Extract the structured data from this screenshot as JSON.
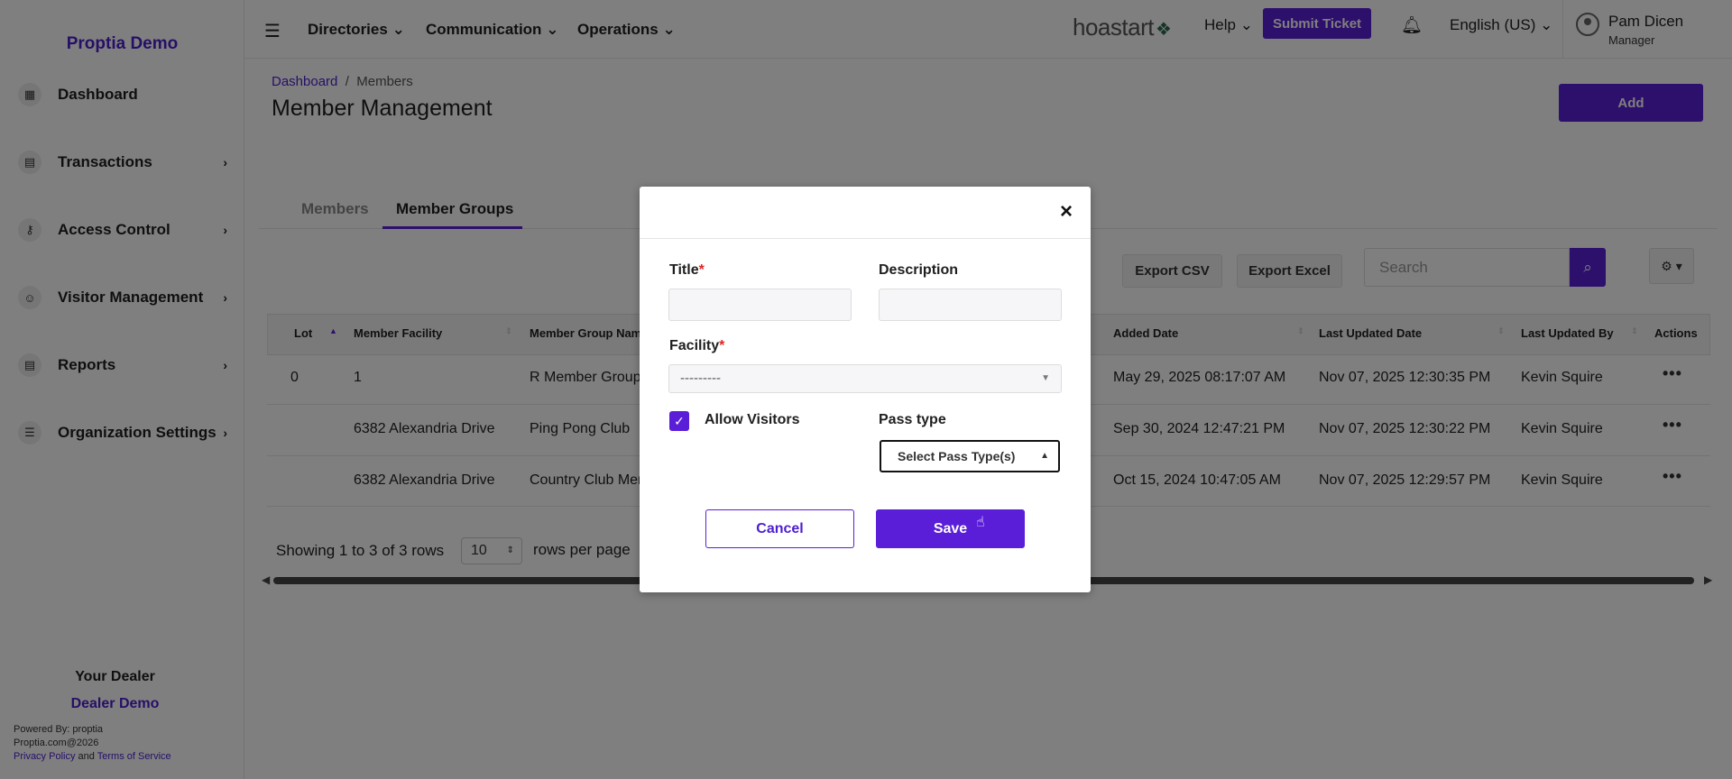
{
  "sidebar": {
    "brand": "Proptia Demo",
    "items": [
      {
        "label": "Dashboard",
        "icon": "dashboard-icon"
      },
      {
        "label": "Transactions",
        "icon": "receipt-icon"
      },
      {
        "label": "Access Control",
        "icon": "key-icon"
      },
      {
        "label": "Visitor Management",
        "icon": "visitor-icon"
      },
      {
        "label": "Reports",
        "icon": "report-icon"
      },
      {
        "label": "Organization Settings",
        "icon": "server-icon"
      }
    ],
    "dealer_title": "Your Dealer",
    "dealer_name": "Dealer Demo",
    "powered_by": "Powered By: proptia",
    "copyright": "Proptia.com@2026",
    "privacy": "Privacy Policy",
    "and": "and",
    "terms": "Terms of Service"
  },
  "topbar": {
    "menus": [
      "Directories",
      "Communication",
      "Operations"
    ],
    "logo": "hoastart",
    "help": "Help",
    "submit_ticket": "Submit Ticket",
    "language": "English (US)",
    "user_name": "Pam Dicen",
    "user_role": "Manager"
  },
  "main": {
    "breadcrumb_home": "Dashboard",
    "breadcrumb_sep": "/",
    "breadcrumb_current": "Members",
    "title": "Member Management",
    "add_label": "Add",
    "tabs": [
      "Members",
      "Member Groups"
    ],
    "export_csv": "Export CSV",
    "export_excel": "Export Excel",
    "search_placeholder": "Search",
    "columns": [
      "Lot",
      "Member Facility",
      "Member Group Name",
      "Added Date",
      "Last Updated Date",
      "Last Updated By",
      "Actions"
    ],
    "rows": [
      {
        "lot": "0",
        "facility": "1",
        "group": "R Member Group",
        "added": "May 29, 2025 08:17:07 AM",
        "updated": "Nov 07, 2025 12:30:35 PM",
        "by": "Kevin Squire"
      },
      {
        "lot": "",
        "facility": "6382 Alexandria Drive",
        "group": "Ping Pong Club",
        "added": "Sep 30, 2024 12:47:21 PM",
        "updated": "Nov 07, 2025 12:30:22 PM",
        "by": "Kevin Squire"
      },
      {
        "lot": "",
        "facility": "6382 Alexandria Drive",
        "group": "Country Club Mer",
        "added": "Oct 15, 2024 10:47:05 AM",
        "updated": "Nov 07, 2025 12:29:57 PM",
        "by": "Kevin Squire"
      }
    ],
    "showing": "Showing 1 to 3 of 3 rows",
    "page_size": "10",
    "rows_per_page": "rows per page"
  },
  "modal": {
    "title_label": "Title",
    "description_label": "Description",
    "facility_label": "Facility",
    "facility_value": "---------",
    "allow_visitors_label": "Allow Visitors",
    "pass_type_label": "Pass type",
    "pass_type_value": "Select Pass Type(s)",
    "cancel_label": "Cancel",
    "save_label": "Save"
  },
  "colors": {
    "accent": "#5b1ed8",
    "brand_text": "#4c1ecf",
    "required": "#e02424"
  }
}
